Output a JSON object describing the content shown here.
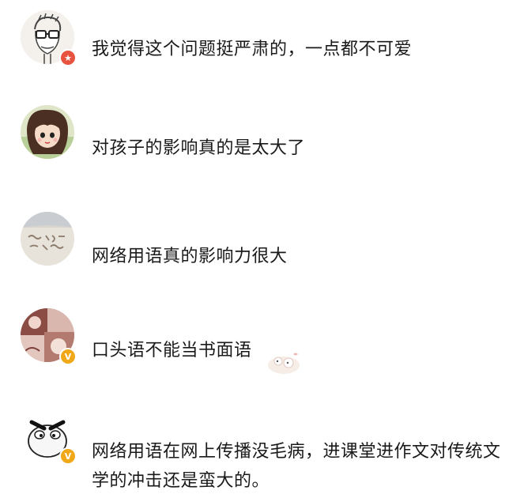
{
  "comments": [
    {
      "avatar_icon": "cartoon-man-glasses-avatar",
      "badge": "star",
      "text": "我觉得这个问题挺严肃的，一点都不可爱"
    },
    {
      "avatar_icon": "anime-girl-avatar",
      "badge": null,
      "text": "对孩子的影响真的是太大了"
    },
    {
      "avatar_icon": "sand-writing-avatar",
      "badge": null,
      "text": "网络用语真的影响力很大"
    },
    {
      "avatar_icon": "photo-collage-avatar",
      "badge": "v",
      "text": "口头语不能当书面语"
    },
    {
      "avatar_icon": "angry-cartoon-avatar",
      "badge": "v",
      "text": "网络用语在网上传播没毛病，进课堂进作文对传统文学的冲击还是蛮大的。"
    }
  ],
  "colors": {
    "star_badge": "#e8533f",
    "v_badge": "#f0a818",
    "text": "#1a1a1a"
  }
}
